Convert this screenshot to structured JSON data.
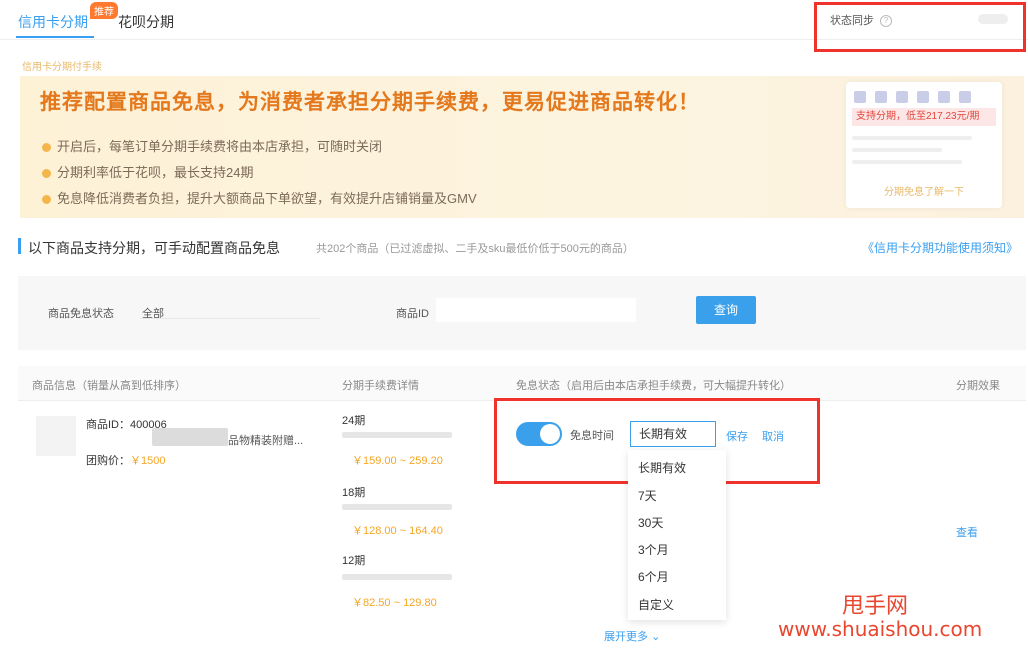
{
  "tabs": [
    {
      "label": "信用卡分期",
      "active": true
    },
    {
      "label": "花呗分期",
      "active": false
    }
  ],
  "tab_badge": "推荐",
  "sync": {
    "label": "状态同步",
    "help_icon": "help-icon"
  },
  "banner": {
    "small": "信用卡分期付手续",
    "title": "推荐配置商品免息，为消费者承担分期手续费，更易促进商品转化！",
    "bullets": [
      "开启后，每笔订单分期手续费将由本店承担，可随时关闭",
      "分期利率低于花呗，最长支持24期",
      "免息降低消费者负担，提升大额商品下单欲望，有效提升店铺销量及GMV"
    ],
    "preview_promo": "支持分期，低至217.23元/期",
    "preview_link": "分期免息了解一下"
  },
  "section": {
    "title": "以下商品支持分期，可手动配置商品免息",
    "count": "共202个商品（已过滤虚拟、二手及sku最低价低于500元的商品）",
    "help_link": "《信用卡分期功能使用须知》"
  },
  "filter": {
    "status_label": "商品免息状态",
    "status_value": "全部",
    "id_label": "商品ID",
    "query_button": "查询"
  },
  "table": {
    "headers": [
      "商品信息（销量从高到低排序）",
      "分期手续费详情",
      "免息状态（启用后由本店承担手续费，可大幅提升转化）",
      "分期效果"
    ],
    "row": {
      "product_id": "商品ID：400006",
      "product_name": "品物精装附赠...",
      "group_price_label": "团购价：",
      "group_price": "￥1500",
      "periods": [
        {
          "label": "24期",
          "fee": "￥159.00 ~ 259.20"
        },
        {
          "label": "18期",
          "fee": "￥128.00 ~ 164.40"
        },
        {
          "label": "12期",
          "fee": "￥82.50 ~ 129.80"
        }
      ],
      "toggle_label": "免息时间",
      "select_value": "长期有效",
      "save": "保存",
      "cancel": "取消",
      "effect_link": "查看",
      "expand_more": "展开更多"
    },
    "dropdown_options": [
      "长期有效",
      "7天",
      "30天",
      "3个月",
      "6个月",
      "自定义"
    ]
  },
  "watermark": {
    "line1": "甩手网",
    "line2": "www.shuaishou.com"
  },
  "colors": {
    "accent": "#3a9ff0",
    "highlight_border": "#f0322c",
    "banner_title": "#e4781c",
    "price": "#f5a623"
  }
}
